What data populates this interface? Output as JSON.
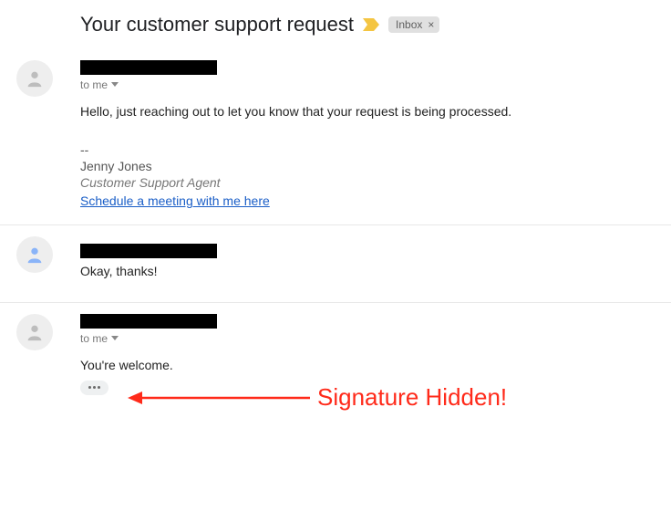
{
  "header": {
    "subject": "Your customer support request",
    "inbox_label": "Inbox"
  },
  "messages": {
    "msg1": {
      "recipient": "to me",
      "body": "Hello, just reaching out to let you know that your request is being processed.",
      "sig_divider": "--",
      "sig_name": "Jenny Jones",
      "sig_title": "Customer Support Agent",
      "sig_link_text": "Schedule a meeting with me here"
    },
    "msg2": {
      "snippet": "Okay, thanks!"
    },
    "msg3": {
      "recipient": "to me",
      "body": "You're welcome."
    }
  },
  "annotation": {
    "text": "Signature Hidden!"
  }
}
